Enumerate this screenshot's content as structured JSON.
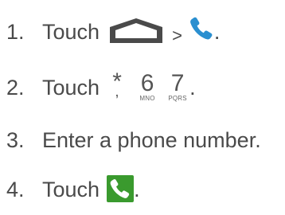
{
  "steps": [
    {
      "number": "1.",
      "text": "Touch",
      "separator": ">",
      "end": ".",
      "icons": [
        "home-icon",
        "phone-icon"
      ],
      "phone_color": "#2a8fd0"
    },
    {
      "number": "2.",
      "text": "Touch",
      "end": ".",
      "keys": [
        {
          "main": "*",
          "sub": ","
        },
        {
          "main": "6",
          "sub": "MNO"
        },
        {
          "main": "7",
          "sub": "PQRS"
        }
      ]
    },
    {
      "number": "3.",
      "text": "Enter a phone number."
    },
    {
      "number": "4.",
      "text": "Touch",
      "end": ".",
      "icons": [
        "call-button-icon"
      ],
      "call_color": "#3a9a2e"
    }
  ]
}
